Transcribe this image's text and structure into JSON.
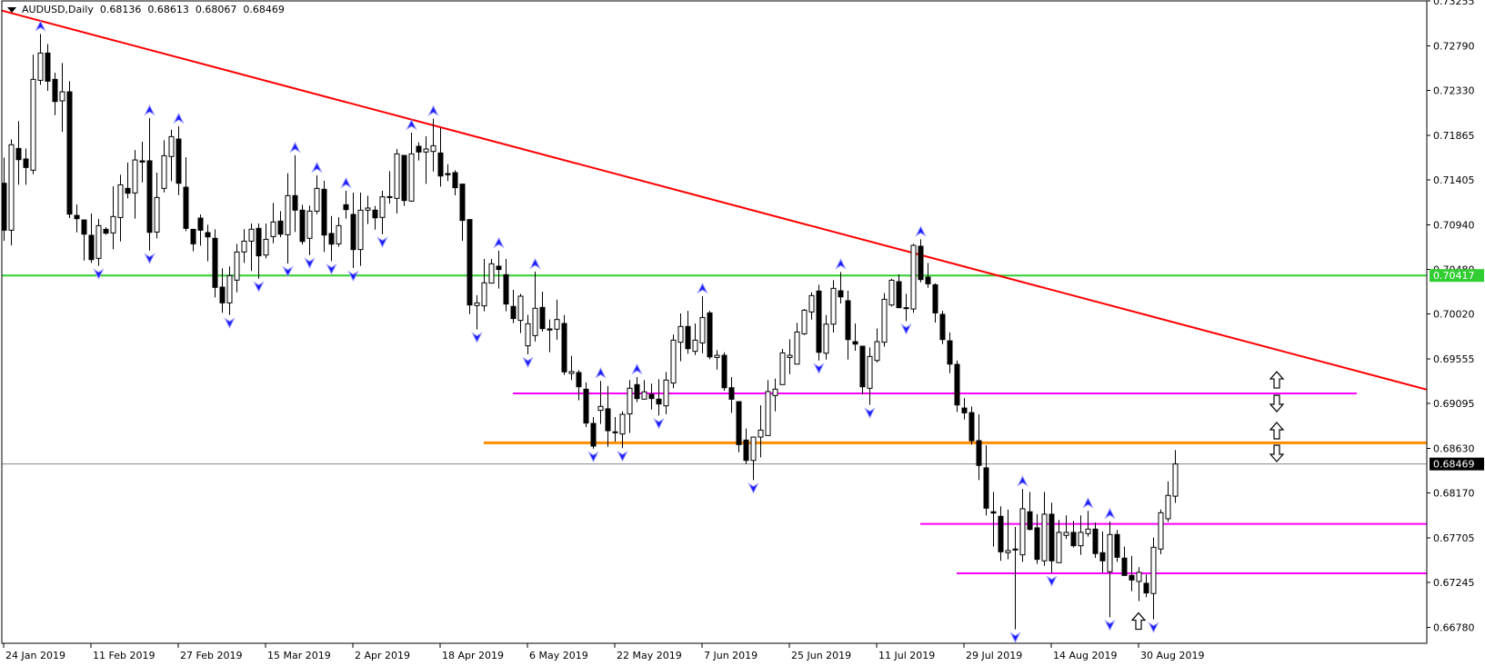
{
  "header": {
    "symbol_timeframe": "AUDUSD,Daily",
    "open": "0.68136",
    "high": "0.68613",
    "low": "0.68067",
    "close": "0.68469"
  },
  "colors": {
    "bull_fill": "#ffffff",
    "bear_fill": "#000000",
    "fractal": "#1a1aff",
    "trendline": "#ff0000",
    "support_green": "#32cd32",
    "level_orange": "#ff8c00",
    "level_magenta": "#ff00ff",
    "current_price": "#808890"
  },
  "chart_data": {
    "type": "candlestick",
    "title": "AUDUSD,Daily",
    "ylim": [
      0.6676,
      0.73264
    ],
    "y_ticks": [
      "0.73255",
      "0.72790",
      "0.72330",
      "0.71865",
      "0.71405",
      "0.70940",
      "0.70480",
      "0.70020",
      "0.69555",
      "0.69095",
      "0.68630",
      "0.68170",
      "0.67705",
      "0.67245",
      "0.66780"
    ],
    "x_ticks": [
      {
        "bar": 0,
        "label": "24 Jan 2019"
      },
      {
        "bar": 12,
        "label": "11 Feb 2019"
      },
      {
        "bar": 24,
        "label": "27 Feb 2019"
      },
      {
        "bar": 36,
        "label": "15 Mar 2019"
      },
      {
        "bar": 48,
        "label": "2 Apr 2019"
      },
      {
        "bar": 60,
        "label": "18 Apr 2019"
      },
      {
        "bar": 72,
        "label": "6 May 2019"
      },
      {
        "bar": 84,
        "label": "22 May 2019"
      },
      {
        "bar": 96,
        "label": "7 Jun 2019"
      },
      {
        "bar": 108,
        "label": "25 Jun 2019"
      },
      {
        "bar": 120,
        "label": "11 Jul 2019"
      },
      {
        "bar": 132,
        "label": "29 Jul 2019"
      },
      {
        "bar": 144,
        "label": "14 Aug 2019"
      },
      {
        "bar": 156,
        "label": "30 Aug 2019"
      }
    ],
    "ohlc_columns": [
      "open",
      "high",
      "low",
      "close"
    ],
    "candles": [
      [
        0.7137,
        0.71636,
        0.70775,
        0.70885
      ],
      [
        0.70885,
        0.71824,
        0.70729,
        0.71768
      ],
      [
        0.7173,
        0.72012,
        0.71354,
        0.71614
      ],
      [
        0.71621,
        0.7173,
        0.71354,
        0.71533
      ],
      [
        0.71505,
        0.727,
        0.71464,
        0.72444
      ],
      [
        0.72434,
        0.72913,
        0.72387,
        0.72716
      ],
      [
        0.72716,
        0.7281,
        0.72325,
        0.72425
      ],
      [
        0.72444,
        0.72513,
        0.72074,
        0.72215
      ],
      [
        0.72222,
        0.72613,
        0.71902,
        0.72315
      ],
      [
        0.72315,
        0.72425,
        0.7101,
        0.71051
      ],
      [
        0.71038,
        0.71151,
        0.70863,
        0.71004
      ],
      [
        0.70991,
        0.70991,
        0.70572,
        0.70844
      ],
      [
        0.70832,
        0.71057,
        0.70547,
        0.70581
      ],
      [
        0.70594,
        0.71001,
        0.70516,
        0.70932
      ],
      [
        0.70894,
        0.70916,
        0.70838,
        0.70854
      ],
      [
        0.70857,
        0.71339,
        0.70688,
        0.71026
      ],
      [
        0.71016,
        0.71458,
        0.70769,
        0.71354
      ],
      [
        0.71317,
        0.71583,
        0.71214,
        0.71267
      ],
      [
        0.7127,
        0.71714,
        0.71004,
        0.71611
      ],
      [
        0.71602,
        0.71799,
        0.7138,
        0.71589
      ],
      [
        0.71602,
        0.72043,
        0.70675,
        0.70863
      ],
      [
        0.70866,
        0.7148,
        0.70801,
        0.71223
      ],
      [
        0.71317,
        0.71815,
        0.71276,
        0.71655
      ],
      [
        0.71646,
        0.71924,
        0.71392,
        0.71852
      ],
      [
        0.71827,
        0.71959,
        0.71248,
        0.7137
      ],
      [
        0.71329,
        0.71639,
        0.70876,
        0.70904
      ],
      [
        0.70894,
        0.70894,
        0.70666,
        0.70744
      ],
      [
        0.7101,
        0.71048,
        0.70725,
        0.70885
      ],
      [
        0.7086,
        0.70941,
        0.70563,
        0.70816
      ],
      [
        0.70801,
        0.70894,
        0.7019,
        0.70294
      ],
      [
        0.70297,
        0.70491,
        0.70031,
        0.70134
      ],
      [
        0.70134,
        0.7051,
        0.70009,
        0.70416
      ],
      [
        0.70369,
        0.70744,
        0.70243,
        0.7066
      ],
      [
        0.7066,
        0.70895,
        0.70547,
        0.70772
      ],
      [
        0.70772,
        0.70954,
        0.70463,
        0.70895
      ],
      [
        0.70904,
        0.70954,
        0.70384,
        0.7062
      ],
      [
        0.70628,
        0.70954,
        0.70594,
        0.70791
      ],
      [
        0.70819,
        0.71167,
        0.7075,
        0.7097
      ],
      [
        0.70979,
        0.71082,
        0.70813,
        0.70844
      ],
      [
        0.70838,
        0.71474,
        0.70541,
        0.71242
      ],
      [
        0.71242,
        0.71658,
        0.70866,
        0.71092
      ],
      [
        0.71092,
        0.71148,
        0.70738,
        0.70769
      ],
      [
        0.70801,
        0.71139,
        0.70628,
        0.71082
      ],
      [
        0.71082,
        0.71452,
        0.7105,
        0.71317
      ],
      [
        0.71308,
        0.71395,
        0.7066,
        0.70835
      ],
      [
        0.70851,
        0.71032,
        0.70566,
        0.70741
      ],
      [
        0.70744,
        0.7102,
        0.70713,
        0.70932
      ],
      [
        0.71148,
        0.71292,
        0.71004,
        0.71098
      ],
      [
        0.71048,
        0.71273,
        0.70494,
        0.70685
      ],
      [
        0.70685,
        0.71273,
        0.70516,
        0.71092
      ],
      [
        0.71092,
        0.71242,
        0.70948,
        0.71114
      ],
      [
        0.71092,
        0.71136,
        0.70891,
        0.71013
      ],
      [
        0.71017,
        0.71292,
        0.70844,
        0.7123
      ],
      [
        0.71232,
        0.71495,
        0.71161,
        0.71223
      ],
      [
        0.71214,
        0.71724,
        0.71057,
        0.71674
      ],
      [
        0.71658,
        0.71658,
        0.71136,
        0.71192
      ],
      [
        0.71186,
        0.71893,
        0.7118,
        0.71674
      ],
      [
        0.71752,
        0.71793,
        0.71605,
        0.71693
      ],
      [
        0.71693,
        0.71855,
        0.71364,
        0.71724
      ],
      [
        0.71699,
        0.72037,
        0.71492,
        0.71758
      ],
      [
        0.71683,
        0.71943,
        0.71336,
        0.71445
      ],
      [
        0.7147,
        0.71567,
        0.71392,
        0.71458
      ],
      [
        0.7148,
        0.71505,
        0.71245,
        0.71324
      ],
      [
        0.71361,
        0.71361,
        0.70776,
        0.70986
      ],
      [
        0.70995,
        0.70995,
        0.70018,
        0.70112
      ],
      [
        0.70106,
        0.70213,
        0.69859,
        0.70134
      ],
      [
        0.70103,
        0.70588,
        0.70047,
        0.70341
      ],
      [
        0.70338,
        0.70588,
        0.70338,
        0.70538
      ],
      [
        0.70513,
        0.70673,
        0.70281,
        0.70479
      ],
      [
        0.70425,
        0.70588,
        0.70047,
        0.70122
      ],
      [
        0.70097,
        0.70269,
        0.69925,
        0.69972
      ],
      [
        0.69953,
        0.70228,
        0.69821,
        0.70203
      ],
      [
        0.6969,
        0.70009,
        0.69602,
        0.69918
      ],
      [
        0.69796,
        0.70457,
        0.69734,
        0.70078
      ],
      [
        0.70087,
        0.7025,
        0.69837,
        0.69868
      ],
      [
        0.69865,
        0.69962,
        0.69624,
        0.69853
      ],
      [
        0.69862,
        0.70166,
        0.69752,
        0.69962
      ],
      [
        0.69921,
        0.70009,
        0.6939,
        0.69421
      ],
      [
        0.69405,
        0.69587,
        0.69336,
        0.69424
      ],
      [
        0.69414,
        0.69439,
        0.69126,
        0.69267
      ],
      [
        0.69242,
        0.69311,
        0.68851,
        0.68892
      ],
      [
        0.68888,
        0.68954,
        0.68626,
        0.68654
      ],
      [
        0.69023,
        0.69327,
        0.68882,
        0.69064
      ],
      [
        0.69039,
        0.69274,
        0.68647,
        0.68813
      ],
      [
        0.68801,
        0.68954,
        0.687,
        0.68792
      ],
      [
        0.68779,
        0.69014,
        0.68632,
        0.68982
      ],
      [
        0.68986,
        0.69336,
        0.68788,
        0.69252
      ],
      [
        0.69289,
        0.69367,
        0.69108,
        0.69145
      ],
      [
        0.69139,
        0.69336,
        0.69139,
        0.69214
      ],
      [
        0.69189,
        0.69299,
        0.69033,
        0.69145
      ],
      [
        0.69139,
        0.69345,
        0.6897,
        0.69089
      ],
      [
        0.6907,
        0.6942,
        0.68983,
        0.69336
      ],
      [
        0.69305,
        0.69806,
        0.69252,
        0.69749
      ],
      [
        0.69727,
        0.70025,
        0.6953,
        0.6989
      ],
      [
        0.6989,
        0.70052,
        0.69608,
        0.69661
      ],
      [
        0.69633,
        0.69921,
        0.69595,
        0.69749
      ],
      [
        0.6972,
        0.70202,
        0.69614,
        0.69983
      ],
      [
        0.7003,
        0.70052,
        0.69551,
        0.69576
      ],
      [
        0.6957,
        0.69645,
        0.69445,
        0.69592
      ],
      [
        0.69592,
        0.69623,
        0.69226,
        0.69257
      ],
      [
        0.69257,
        0.69367,
        0.68997,
        0.69138
      ],
      [
        0.69113,
        0.69113,
        0.6859,
        0.68669
      ],
      [
        0.68716,
        0.68835,
        0.68468,
        0.68506
      ],
      [
        0.68506,
        0.68747,
        0.68302,
        0.68747
      ],
      [
        0.68747,
        0.69076,
        0.68537,
        0.68819
      ],
      [
        0.68763,
        0.69336,
        0.68763,
        0.69217
      ],
      [
        0.69176,
        0.69351,
        0.69013,
        0.69242
      ],
      [
        0.69289,
        0.69658,
        0.69289,
        0.69617
      ],
      [
        0.6957,
        0.69758,
        0.69398,
        0.69592
      ],
      [
        0.69501,
        0.69927,
        0.69501,
        0.69833
      ],
      [
        0.69814,
        0.70071,
        0.69802,
        0.70058
      ],
      [
        0.7004,
        0.70243,
        0.69961,
        0.70209
      ],
      [
        0.70256,
        0.70321,
        0.69539,
        0.69623
      ],
      [
        0.69614,
        0.70008,
        0.69548,
        0.69914
      ],
      [
        0.69914,
        0.70368,
        0.69827,
        0.70284
      ],
      [
        0.70259,
        0.70453,
        0.70127,
        0.70196
      ],
      [
        0.70156,
        0.70259,
        0.69548,
        0.69755
      ],
      [
        0.69733,
        0.69921,
        0.6964,
        0.69708
      ],
      [
        0.69686,
        0.69686,
        0.69188,
        0.69267
      ],
      [
        0.69251,
        0.69674,
        0.69079,
        0.6958
      ],
      [
        0.69539,
        0.69868,
        0.69517,
        0.69733
      ],
      [
        0.69727,
        0.70234,
        0.6968,
        0.70171
      ],
      [
        0.70112,
        0.70384,
        0.70096,
        0.70368
      ],
      [
        0.70353,
        0.70428,
        0.70084,
        0.70084
      ],
      [
        0.70084,
        0.70228,
        0.69946,
        0.70077
      ],
      [
        0.70071,
        0.70744,
        0.7003,
        0.70728
      ],
      [
        0.70719,
        0.70791,
        0.70346,
        0.70375
      ],
      [
        0.704,
        0.70547,
        0.7029,
        0.70331
      ],
      [
        0.70321,
        0.70337,
        0.6993,
        0.7003
      ],
      [
        0.70015,
        0.70052,
        0.69708,
        0.69755
      ],
      [
        0.69742,
        0.69827,
        0.69407,
        0.69501
      ],
      [
        0.69498,
        0.69539,
        0.69007,
        0.69079
      ],
      [
        0.69047,
        0.6915,
        0.68929,
        0.68997
      ],
      [
        0.69,
        0.69063,
        0.68669,
        0.68709
      ],
      [
        0.6871,
        0.68982,
        0.68303,
        0.68454
      ],
      [
        0.68429,
        0.68663,
        0.67937,
        0.68012
      ],
      [
        0.67975,
        0.6818,
        0.67615,
        0.67962
      ],
      [
        0.67928,
        0.68031,
        0.67468,
        0.67561
      ],
      [
        0.67552,
        0.67997,
        0.67483,
        0.67574
      ],
      [
        0.6759,
        0.67818,
        0.6676,
        0.6758
      ],
      [
        0.6753,
        0.6821,
        0.67458,
        0.68006
      ],
      [
        0.67975,
        0.6818,
        0.67781,
        0.67793
      ],
      [
        0.67809,
        0.6795,
        0.67436,
        0.67483
      ],
      [
        0.67468,
        0.6818,
        0.67418,
        0.6795
      ],
      [
        0.6795,
        0.68069,
        0.67342,
        0.67468
      ],
      [
        0.67449,
        0.6789,
        0.67449,
        0.67762
      ],
      [
        0.67731,
        0.67937,
        0.67693,
        0.67762
      ],
      [
        0.67762,
        0.67881,
        0.67605,
        0.67624
      ],
      [
        0.67624,
        0.67937,
        0.6753,
        0.67762
      ],
      [
        0.67749,
        0.67984,
        0.67718,
        0.67796
      ],
      [
        0.67796,
        0.67865,
        0.67499,
        0.67543
      ],
      [
        0.67552,
        0.67771,
        0.67342,
        0.67468
      ],
      [
        0.67355,
        0.67874,
        0.66885,
        0.6774
      ],
      [
        0.6774,
        0.67787,
        0.67458,
        0.67505
      ],
      [
        0.67496,
        0.67615,
        0.67317,
        0.67317
      ],
      [
        0.67317,
        0.6752,
        0.67155,
        0.6727
      ],
      [
        0.67255,
        0.67402,
        0.67051,
        0.67349
      ],
      [
        0.67236,
        0.67327,
        0.67092,
        0.67136
      ],
      [
        0.6713,
        0.67709,
        0.66863,
        0.67608
      ],
      [
        0.6759,
        0.67999,
        0.67536,
        0.67965
      ],
      [
        0.67903,
        0.68288,
        0.67871,
        0.68144
      ],
      [
        0.68136,
        0.68613,
        0.68067,
        0.68469
      ]
    ],
    "trendline": {
      "p1": {
        "bar": 0,
        "price": 0.7315
      },
      "p2": {
        "bar": 156,
        "price": 0.7003
      },
      "extend_right": true
    },
    "horizontal_lines": [
      {
        "name": "green-support-line",
        "price": 0.70417,
        "color": "#32cd32",
        "from_bar": -1,
        "to_bar": null,
        "label": "0.70417",
        "label_bg": "#32cd32"
      },
      {
        "name": "magenta-upper-line",
        "price": 0.69198,
        "color": "#ff00ff",
        "from_bar": 70,
        "to_bar": 186
      },
      {
        "name": "orange-level-line",
        "price": 0.68688,
        "color": "#ff8c00",
        "from_bar": 66,
        "to_bar": null
      },
      {
        "name": "current-price-line",
        "price": 0.68469,
        "color": "#808890",
        "from_bar": -1,
        "to_bar": null,
        "label": "0.68469",
        "label_bg": "#000000"
      },
      {
        "name": "magenta-middle-line",
        "price": 0.67849,
        "color": "#ff00ff",
        "from_bar": 126,
        "to_bar": null
      },
      {
        "name": "magenta-lower-line",
        "price": 0.67339,
        "color": "#ff00ff",
        "from_bar": 131,
        "to_bar": null
      }
    ],
    "signal_arrows": [
      {
        "bar": 156,
        "price": 0.6693,
        "dir": "up"
      },
      {
        "bar": 175,
        "price": 0.69423,
        "dir": "up"
      },
      {
        "bar": 175,
        "price": 0.69179,
        "dir": "down"
      },
      {
        "bar": 175,
        "price": 0.68898,
        "dir": "up"
      },
      {
        "bar": 175,
        "price": 0.68663,
        "dir": "down"
      }
    ],
    "fractals": "auto (5-bar Bill Williams fractals)"
  }
}
